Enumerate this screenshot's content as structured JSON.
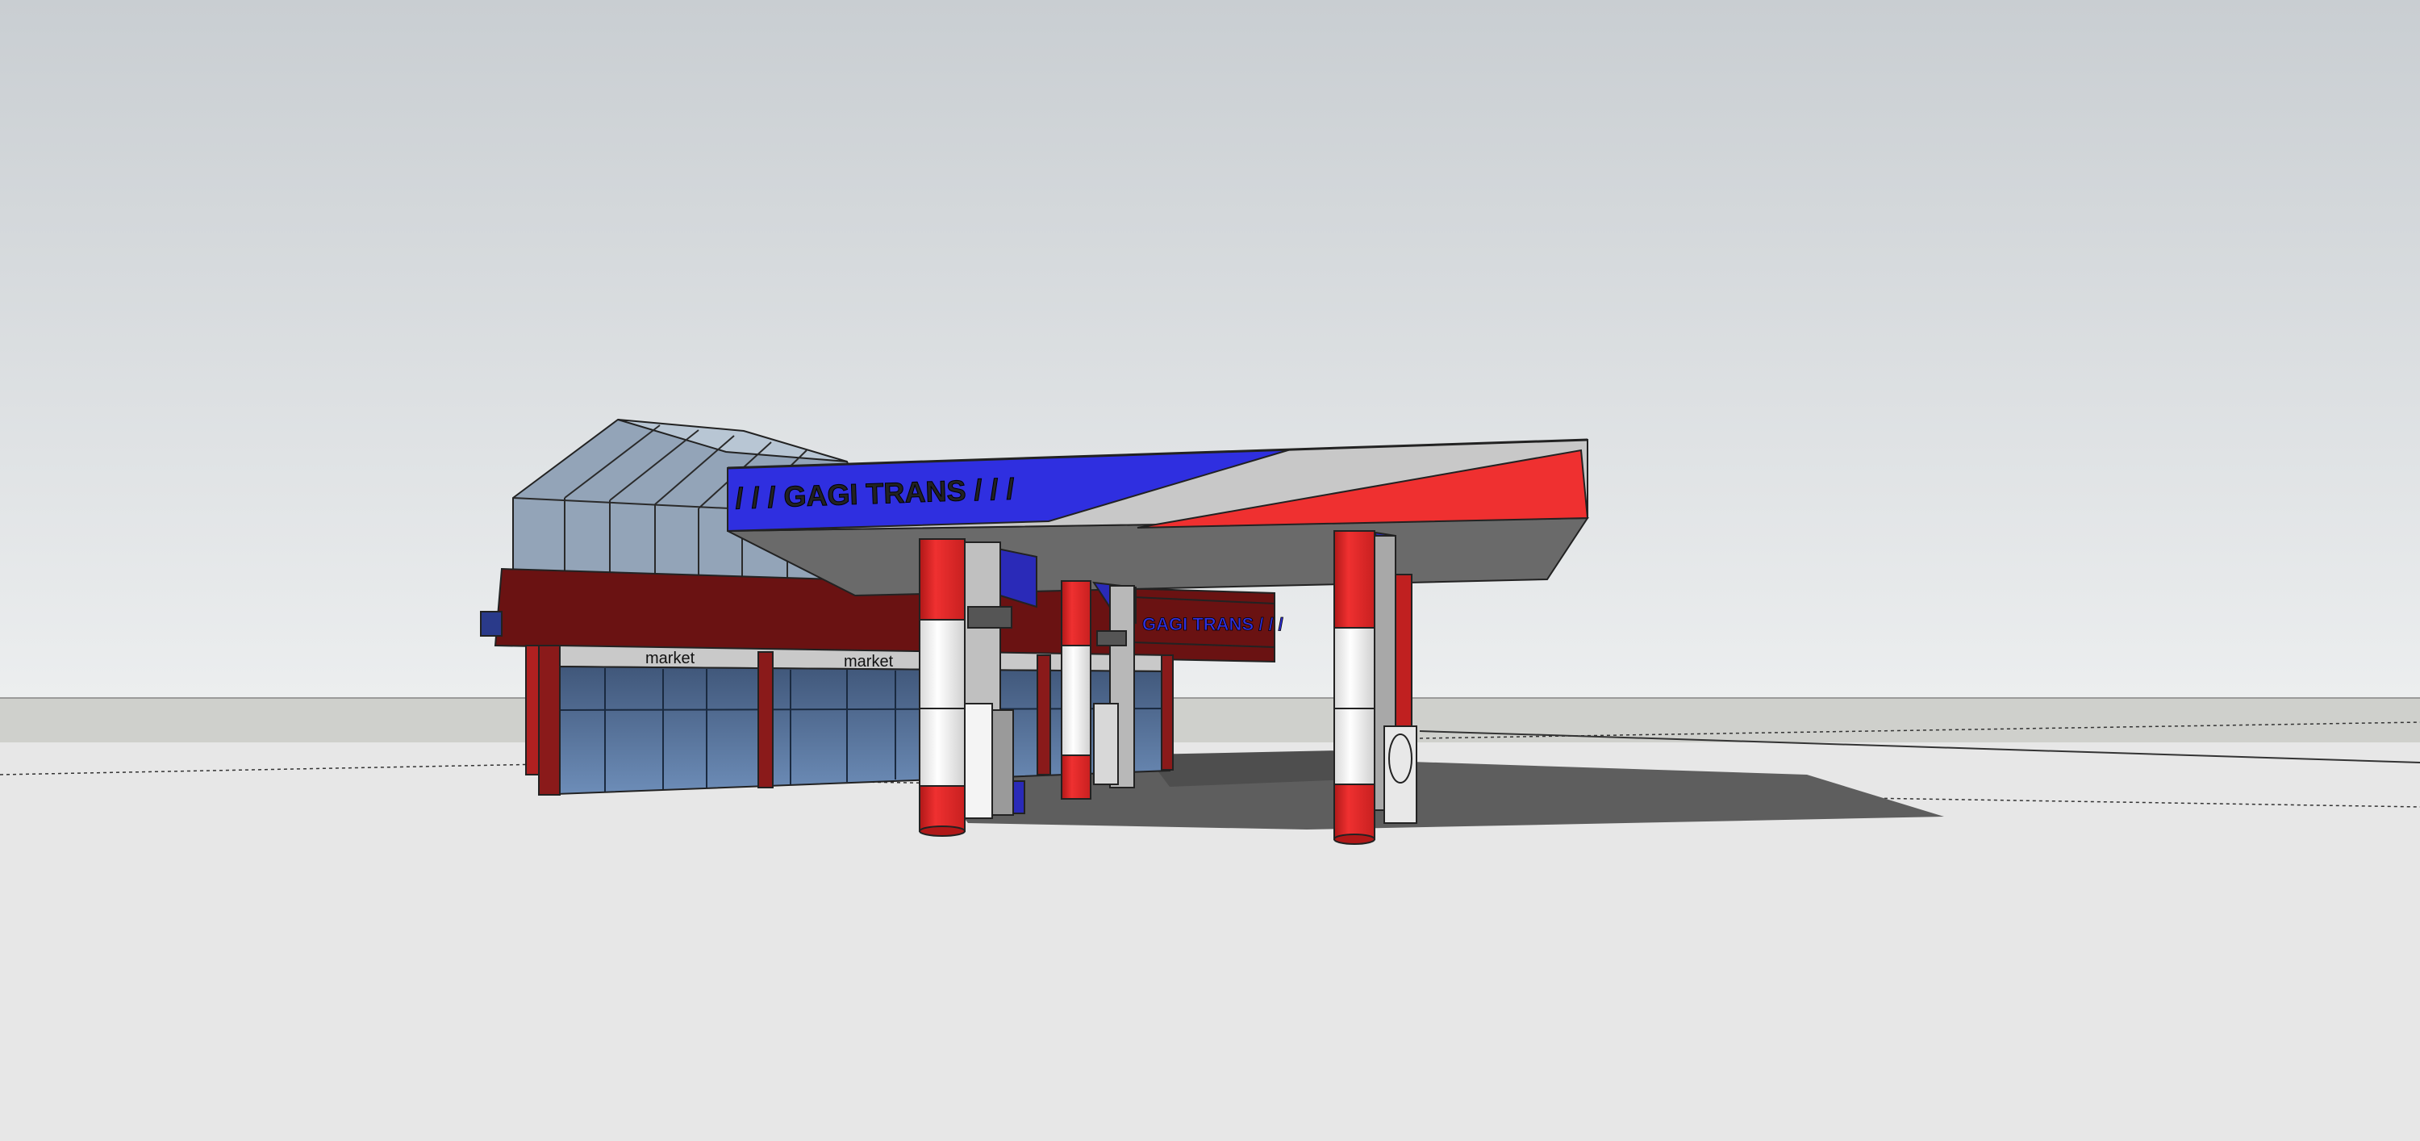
{
  "scene": {
    "canopy_sign": "/ / / GAGI TRANS / / /",
    "canopy_sign_word": "GAGI TRANS",
    "side_sign": "GAGI TRANS / / /",
    "market_label_1": "market",
    "market_label_2": "market"
  },
  "colors": {
    "sky_top": "#c9ced2",
    "sky_bottom": "#eceeef",
    "ground": "#e7e7e7",
    "horizon_band": "#cfd0cc",
    "brand_blue": "#2f2fe0",
    "brand_red": "#ef3030",
    "canopy_grey": "#c8c8c8",
    "canopy_underside": "#6a6a6a",
    "building_red": "#6a1212",
    "glass": "#5f7ea8",
    "shadow": "#5e5e5e"
  }
}
